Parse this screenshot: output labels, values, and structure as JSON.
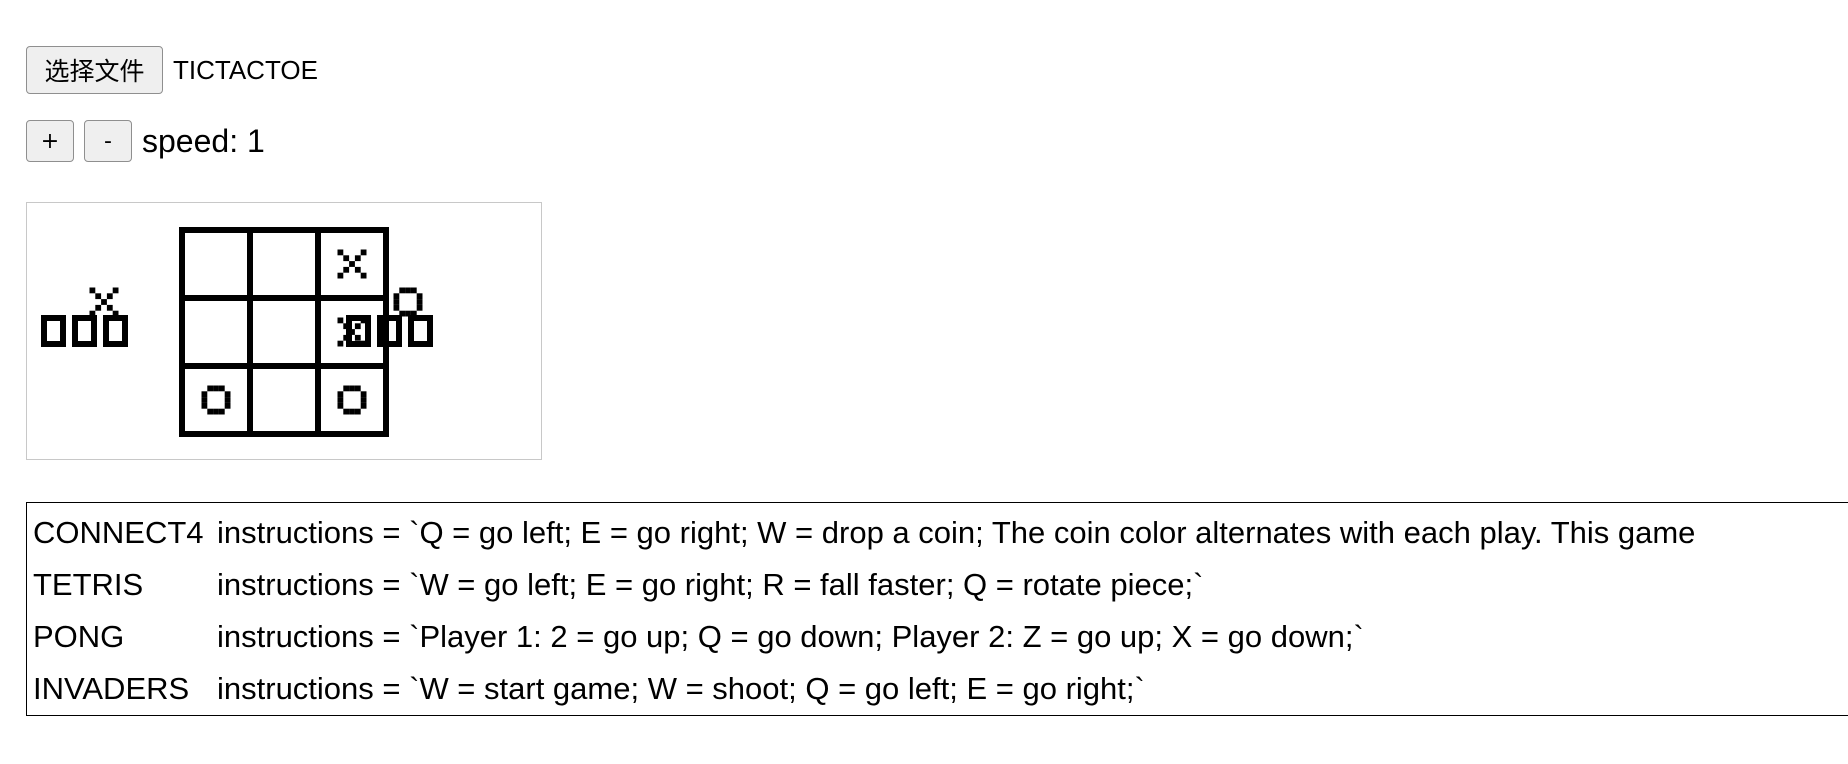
{
  "file_picker": {
    "button_label": "选择文件",
    "file_name": "TICTACTOE"
  },
  "speed_controls": {
    "plus_label": "+",
    "minus_label": "-",
    "speed_text": "speed: 1"
  },
  "game": {
    "name": "TICTACTOE",
    "board": [
      [
        "",
        "",
        "X"
      ],
      [
        "",
        "",
        "X"
      ],
      [
        "O",
        "",
        "O"
      ]
    ],
    "player_x_symbol": "X",
    "player_o_symbol": "O",
    "player_x_score_boxes": 3,
    "player_o_score_boxes": 3
  },
  "instructions": [
    {
      "game": "CONNECT4",
      "text": "instructions = `Q = go left; E = go right; W = drop a coin; The coin color alternates with each play. This game"
    },
    {
      "game": "TETRIS",
      "text": "instructions = `W = go left; E = go right; R = fall faster; Q = rotate piece;`"
    },
    {
      "game": "PONG",
      "text": "instructions = `Player 1: 2 = go up; Q = go down; Player 2: Z = go up; X = go down;`"
    },
    {
      "game": "INVADERS",
      "text": "instructions = `W = start game; W = shoot; Q = go left; E = go right;`"
    }
  ]
}
